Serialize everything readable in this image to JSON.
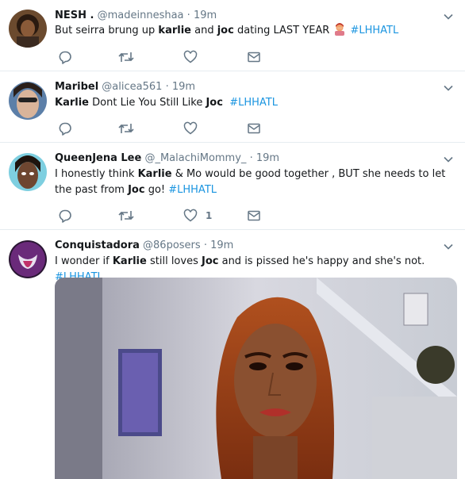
{
  "tweets": [
    {
      "name": "NESH .",
      "handle": "@madeinneshaa",
      "time": "19m",
      "text_parts": [
        "But seirra brung up ",
        "karlie",
        " and ",
        "joc",
        " dating LAST YEAR ",
        "#LHHATL"
      ],
      "emoji": "person-facepalming-emoji",
      "like_count": ""
    },
    {
      "name": "Maribel",
      "handle": "@alicea561",
      "time": "19m",
      "text_parts": [
        "Karlie",
        " Dont Lie You Still Like ",
        "Joc",
        "  ",
        "#LHHATL"
      ],
      "like_count": ""
    },
    {
      "name": "QueenJena Lee",
      "handle": "@_MalachiMommy_",
      "time": "19m",
      "text_parts": [
        "I honestly think ",
        "Karlie",
        " & Mo would be good together , BUT she needs to let the past from ",
        "Joc",
        " go! ",
        "#LHHATL"
      ],
      "like_count": "1"
    },
    {
      "name": "Conquistadora",
      "handle": "@86posers",
      "time": "19m",
      "text_parts": [
        "I wonder if ",
        "Karlie",
        " still loves ",
        "Joc",
        " and is pissed he's happy and she's not. ",
        "#LHHATL"
      ],
      "media": "gif-woman-reality-tv",
      "like_count": ""
    }
  ],
  "separator": "·",
  "icons": {
    "reply": "reply-icon",
    "retweet": "retweet-icon",
    "like": "heart-icon",
    "dm": "envelope-icon",
    "caret": "chevron-down-icon"
  },
  "colors": {
    "text": "#14171a",
    "muted": "#657786",
    "link": "#1b95e0",
    "border": "#e6ecf0"
  }
}
